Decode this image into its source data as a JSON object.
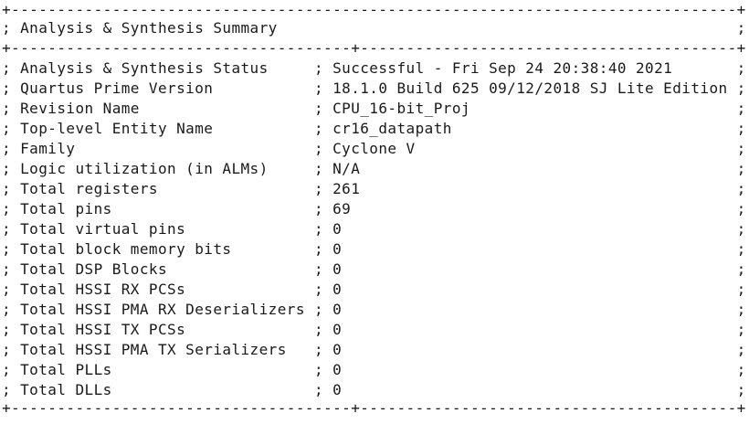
{
  "report": {
    "border_line": "+-------------------------------------------------------------------------------+",
    "middle_border_line": "+-------------------------------------+-----------------------------------------+",
    "title_line": "; Analysis & Synthesis Summary                                                  ;",
    "rows": [
      "; Analysis & Synthesis Status     ; Successful - Fri Sep 24 20:38:40 2021       ;",
      "; Quartus Prime Version           ; 18.1.0 Build 625 09/12/2018 SJ Lite Edition ;",
      "; Revision Name                   ; CPU_16-bit_Proj                             ;",
      "; Top-level Entity Name           ; cr16_datapath                               ;",
      "; Family                          ; Cyclone V                                   ;",
      "; Logic utilization (in ALMs)     ; N/A                                         ;",
      "; Total registers                 ; 261                                         ;",
      "; Total pins                      ; 69                                          ;",
      "; Total virtual pins              ; 0                                           ;",
      "; Total block memory bits         ; 0                                           ;",
      "; Total DSP Blocks                ; 0                                           ;",
      "; Total HSSI RX PCSs              ; 0                                           ;",
      "; Total HSSI PMA RX Deserializers ; 0                                           ;",
      "; Total HSSI TX PCSs              ; 0                                           ;",
      "; Total HSSI PMA TX Serializers   ; 0                                           ;",
      "; Total PLLs                      ; 0                                           ;",
      "; Total DLLs                      ; 0                                           ;"
    ],
    "bottom_border_line": "+-------------------------------------+-----------------------------------------+"
  }
}
